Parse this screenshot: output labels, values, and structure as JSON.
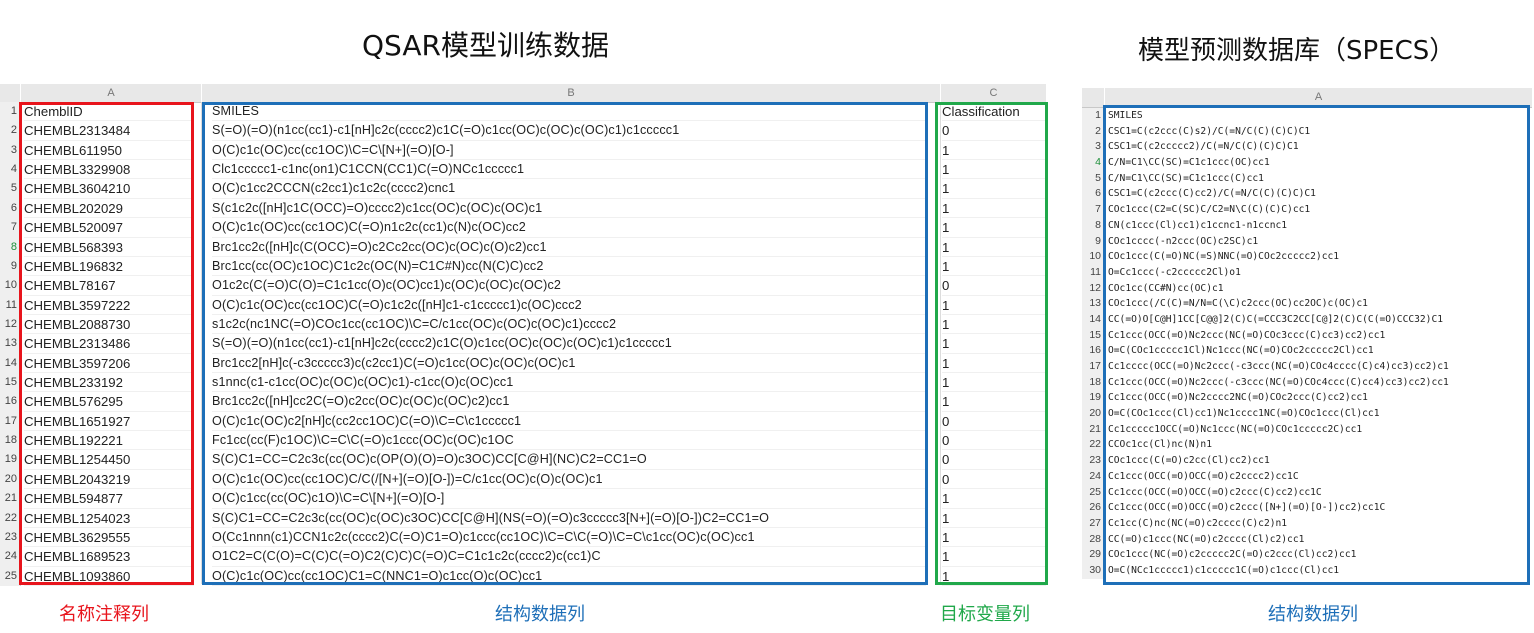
{
  "titles": {
    "left": "QSAR模型训练数据",
    "right": "模型预测数据库（SPECS）"
  },
  "left_sheet": {
    "column_letters": [
      "A",
      "B",
      "C"
    ],
    "highlighted_row": "8",
    "rows": [
      {
        "n": "1",
        "a": "ChemblID",
        "b": "SMILES",
        "c": "Classification"
      },
      {
        "n": "2",
        "a": "CHEMBL2313484",
        "b": "S(=O)(=O)(n1cc(cc1)-c1[nH]c2c(cccc2)c1C(=O)c1cc(OC)c(OC)c(OC)c1)c1ccccc1",
        "c": "0"
      },
      {
        "n": "3",
        "a": "CHEMBL611950",
        "b": "O(C)c1c(OC)cc(cc1OC)\\C=C\\[N+](=O)[O-]",
        "c": "1"
      },
      {
        "n": "4",
        "a": "CHEMBL3329908",
        "b": "Clc1ccccc1-c1nc(on1)C1CCN(CC1)C(=O)NCc1ccccc1",
        "c": "1"
      },
      {
        "n": "5",
        "a": "CHEMBL3604210",
        "b": "O(C)c1cc2CCCN(c2cc1)c1c2c(cccc2)cnc1",
        "c": "1"
      },
      {
        "n": "6",
        "a": "CHEMBL202029",
        "b": "S(c1c2c([nH]c1C(OCC)=O)cccc2)c1cc(OC)c(OC)c(OC)c1",
        "c": "1"
      },
      {
        "n": "7",
        "a": "CHEMBL520097",
        "b": "O(C)c1c(OC)cc(cc1OC)C(=O)n1c2c(cc1)c(N)c(OC)cc2",
        "c": "1"
      },
      {
        "n": "8",
        "a": "CHEMBL568393",
        "b": "Brc1cc2c([nH]c(C(OCC)=O)c2Cc2cc(OC)c(OC)c(O)c2)cc1",
        "c": "1"
      },
      {
        "n": "9",
        "a": "CHEMBL196832",
        "b": "Brc1cc(cc(OC)c1OC)C1c2c(OC(N)=C1C#N)cc(N(C)C)cc2",
        "c": "1"
      },
      {
        "n": "10",
        "a": "CHEMBL78167",
        "b": "O1c2c(C(=O)C(O)=C1c1cc(O)c(OC)cc1)c(OC)c(OC)c(OC)c2",
        "c": "0"
      },
      {
        "n": "11",
        "a": "CHEMBL3597222",
        "b": "O(C)c1c(OC)cc(cc1OC)C(=O)c1c2c([nH]c1-c1ccccc1)c(OC)ccc2",
        "c": "1"
      },
      {
        "n": "12",
        "a": "CHEMBL2088730",
        "b": "s1c2c(nc1NC(=O)COc1cc(cc1OC)\\C=C/c1cc(OC)c(OC)c(OC)c1)cccc2",
        "c": "1"
      },
      {
        "n": "13",
        "a": "CHEMBL2313486",
        "b": "S(=O)(=O)(n1cc(cc1)-c1[nH]c2c(cccc2)c1C(O)c1cc(OC)c(OC)c(OC)c1)c1ccccc1",
        "c": "1"
      },
      {
        "n": "14",
        "a": "CHEMBL3597206",
        "b": "Brc1cc2[nH]c(-c3ccccc3)c(c2cc1)C(=O)c1cc(OC)c(OC)c(OC)c1",
        "c": "1"
      },
      {
        "n": "15",
        "a": "CHEMBL233192",
        "b": "s1nnc(c1-c1cc(OC)c(OC)c(OC)c1)-c1cc(O)c(OC)cc1",
        "c": "1"
      },
      {
        "n": "16",
        "a": "CHEMBL576295",
        "b": "Brc1cc2c([nH]cc2C(=O)c2cc(OC)c(OC)c(OC)c2)cc1",
        "c": "1"
      },
      {
        "n": "17",
        "a": "CHEMBL1651927",
        "b": "O(C)c1c(OC)c2[nH]c(cc2cc1OC)C(=O)\\C=C\\c1ccccc1",
        "c": "0"
      },
      {
        "n": "18",
        "a": "CHEMBL192221",
        "b": "Fc1cc(cc(F)c1OC)\\C=C\\C(=O)c1ccc(OC)c(OC)c1OC",
        "c": "0"
      },
      {
        "n": "19",
        "a": "CHEMBL1254450",
        "b": "S(C)C1=CC=C2c3c(cc(OC)c(OP(O)(O)=O)c3OC)CC[C@H](NC)C2=CC1=O",
        "c": "0"
      },
      {
        "n": "20",
        "a": "CHEMBL2043219",
        "b": "O(C)c1c(OC)cc(cc1OC)C/C(/[N+](=O)[O-])=C/c1cc(OC)c(O)c(OC)c1",
        "c": "0"
      },
      {
        "n": "21",
        "a": "CHEMBL594877",
        "b": "O(C)c1cc(cc(OC)c1O)\\C=C\\[N+](=O)[O-]",
        "c": "1"
      },
      {
        "n": "22",
        "a": "CHEMBL1254023",
        "b": "S(C)C1=CC=C2c3c(cc(OC)c(OC)c3OC)CC[C@H](NS(=O)(=O)c3ccccc3[N+](=O)[O-])C2=CC1=O",
        "c": "1"
      },
      {
        "n": "23",
        "a": "CHEMBL3629555",
        "b": "O(Cc1nnn(c1)CCN1c2c(cccc2)C(=O)C1=O)c1ccc(cc1OC)\\C=C\\C(=O)\\C=C\\c1cc(OC)c(OC)cc1",
        "c": "1"
      },
      {
        "n": "24",
        "a": "CHEMBL1689523",
        "b": "O1C2=C(C(O)=C(C)C(=O)C2(C)C)C(=O)C=C1c1c2c(cccc2)c(cc1)C",
        "c": "1"
      },
      {
        "n": "25",
        "a": "CHEMBL1093860",
        "b": "O(C)c1c(OC)cc(cc1OC)C1=C(NNC1=O)c1cc(O)c(OC)cc1",
        "c": "1"
      }
    ]
  },
  "right_sheet": {
    "column_letter": "A",
    "highlighted_row": "4",
    "rows": [
      {
        "n": "1",
        "v": "SMILES"
      },
      {
        "n": "2",
        "v": "CSC1=C(c2ccc(C)s2)/C(=N/C(C)(C)C)C1"
      },
      {
        "n": "3",
        "v": "CSC1=C(c2ccccc2)/C(=N/C(C)(C)C)C1"
      },
      {
        "n": "4",
        "v": "C/N=C1\\CC(SC)=C1c1ccc(OC)cc1"
      },
      {
        "n": "5",
        "v": "C/N=C1\\CC(SC)=C1c1ccc(C)cc1"
      },
      {
        "n": "6",
        "v": "CSC1=C(c2ccc(C)cc2)/C(=N/C(C)(C)C)C1"
      },
      {
        "n": "7",
        "v": "COc1ccc(C2=C(SC)C/C2=N\\C(C)(C)C)cc1"
      },
      {
        "n": "8",
        "v": "CN(c1ccc(Cl)cc1)c1ccnc1-n1ccnc1"
      },
      {
        "n": "9",
        "v": "COc1cccc(-n2ccc(OC)c2SC)c1"
      },
      {
        "n": "10",
        "v": "COc1ccc(C(=O)NC(=S)NNC(=O)COc2ccccc2)cc1"
      },
      {
        "n": "11",
        "v": "O=Cc1ccc(-c2ccccc2Cl)o1"
      },
      {
        "n": "12",
        "v": "COc1cc(CC#N)cc(OC)c1"
      },
      {
        "n": "13",
        "v": "COc1ccc(/C(C)=N/N=C(\\C)c2ccc(OC)cc2OC)c(OC)c1"
      },
      {
        "n": "14",
        "v": "CC(=O)O[C@H]1CC[C@@]2(C)C(=CCC3C2CC[C@]2(C)C(C(=O)CCC32)C1"
      },
      {
        "n": "15",
        "v": "Cc1ccc(OCC(=O)Nc2ccc(NC(=O)COc3ccc(C)cc3)cc2)cc1"
      },
      {
        "n": "16",
        "v": "O=C(COc1ccccc1Cl)Nc1ccc(NC(=O)COc2ccccc2Cl)cc1"
      },
      {
        "n": "17",
        "v": "Cc1cccc(OCC(=O)Nc2ccc(-c3ccc(NC(=O)COc4cccc(C)c4)cc3)cc2)c1"
      },
      {
        "n": "18",
        "v": "Cc1ccc(OCC(=O)Nc2ccc(-c3ccc(NC(=O)COc4ccc(C)cc4)cc3)cc2)cc1"
      },
      {
        "n": "19",
        "v": "Cc1ccc(OCC(=O)Nc2cccc2NC(=O)COc2ccc(C)cc2)cc1"
      },
      {
        "n": "20",
        "v": "O=C(COc1ccc(Cl)cc1)Nc1cccc1NC(=O)COc1ccc(Cl)cc1"
      },
      {
        "n": "21",
        "v": "Cc1ccccc1OCC(=O)Nc1ccc(NC(=O)COc1ccccc2C)cc1"
      },
      {
        "n": "22",
        "v": "CCOc1cc(Cl)nc(N)n1"
      },
      {
        "n": "23",
        "v": "COc1ccc(C(=O)c2cc(Cl)cc2)cc1"
      },
      {
        "n": "24",
        "v": "Cc1ccc(OCC(=O)OCC(=O)c2cccc2)cc1C"
      },
      {
        "n": "25",
        "v": "Cc1ccc(OCC(=O)OCC(=O)c2ccc(C)cc2)cc1C"
      },
      {
        "n": "26",
        "v": "Cc1ccc(OCC(=O)OCC(=O)c2ccc([N+](=O)[O-])cc2)cc1C"
      },
      {
        "n": "27",
        "v": "Cc1cc(C)nc(NC(=O)c2cccc(C)c2)n1"
      },
      {
        "n": "28",
        "v": "CC(=O)c1ccc(NC(=O)c2cccc(Cl)c2)cc1"
      },
      {
        "n": "29",
        "v": "COc1ccc(NC(=O)c2ccccc2C(=O)c2ccc(Cl)cc2)cc1"
      },
      {
        "n": "30",
        "v": "O=C(NCc1ccccc1)c1ccccc1C(=O)c1ccc(Cl)cc1"
      }
    ]
  },
  "captions": {
    "red": "名称注释列",
    "blue_left": "结构数据列",
    "green": "目标变量列",
    "blue_right": "结构数据列"
  },
  "colors": {
    "red": "#e8141c",
    "blue": "#1e6fb8",
    "green": "#20a84a",
    "highlight_rownum": "#1e8f3b"
  }
}
